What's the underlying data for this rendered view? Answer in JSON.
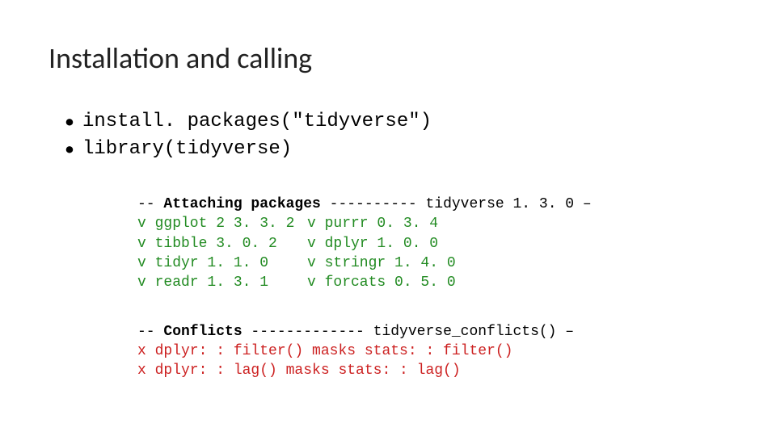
{
  "title": "Installation and calling",
  "bullets": {
    "install": "install. packages(\"tidyverse\")",
    "library": "library(tidyverse)"
  },
  "attach": {
    "dashes_prefix": "-- ",
    "header": "Attaching packages",
    "header_rest": " ---------- tidyverse 1. 3. 0 –",
    "left": {
      "r1": "v ggplot 2 3. 3. 2",
      "r2": "v tibble 3. 0. 2",
      "r3": "v tidyr 1. 1. 0",
      "r4": "v readr 1. 3. 1"
    },
    "right": {
      "r1": "v purrr 0. 3. 4",
      "r2": "v dplyr 1. 0. 0",
      "r3": "v stringr 1. 4. 0",
      "r4": "v forcats 0. 5. 0"
    }
  },
  "conflicts": {
    "dashes_prefix": "-- ",
    "header": "Conflicts",
    "header_rest": " ------------- tidyverse_conflicts() –",
    "line1": "x dplyr: : filter() masks stats: : filter()",
    "line2": "x dplyr: : lag() masks stats: : lag()"
  }
}
